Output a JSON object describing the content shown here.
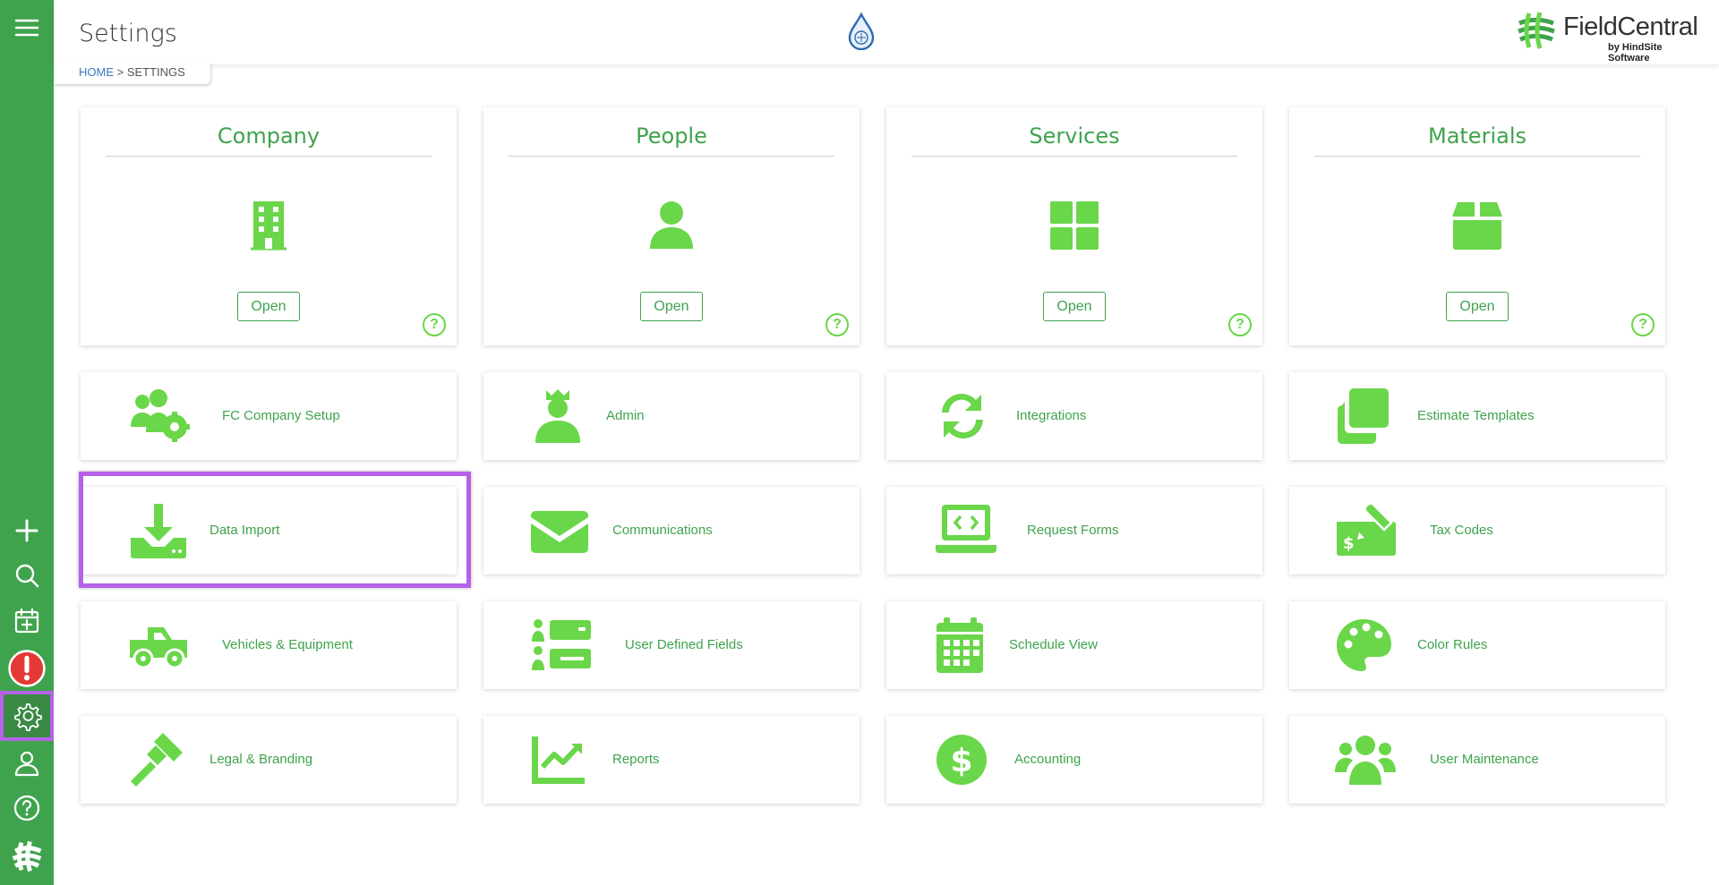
{
  "header": {
    "title": "Settings",
    "breadcrumb_home": "HOME",
    "breadcrumb_sep": " > ",
    "breadcrumb_current": "SETTINGS",
    "brand_name": "FieldCentral",
    "brand_sub": "by HindSite Software"
  },
  "sidebar": {
    "items": [
      {
        "icon": "menu-icon"
      },
      {
        "icon": "plus-icon"
      },
      {
        "icon": "search-icon"
      },
      {
        "icon": "calendar-add-icon"
      },
      {
        "icon": "alert-icon"
      },
      {
        "icon": "gear-icon",
        "active": true
      },
      {
        "icon": "user-icon"
      },
      {
        "icon": "help-icon"
      },
      {
        "icon": "fieldcentral-logo-icon"
      }
    ]
  },
  "main_cards": [
    {
      "title": "Company",
      "icon": "building-icon",
      "button": "Open",
      "help": "?"
    },
    {
      "title": "People",
      "icon": "person-icon",
      "button": "Open",
      "help": "?"
    },
    {
      "title": "Services",
      "icon": "grid-icon",
      "button": "Open",
      "help": "?"
    },
    {
      "title": "Materials",
      "icon": "box-icon",
      "button": "Open",
      "help": "?"
    }
  ],
  "tiles": [
    {
      "label": "FC Company Setup",
      "icon": "users-gear-icon"
    },
    {
      "label": "Admin",
      "icon": "admin-user-icon"
    },
    {
      "label": "Integrations",
      "icon": "sync-icon"
    },
    {
      "label": "Estimate Templates",
      "icon": "clone-icon"
    },
    {
      "label": "Data Import",
      "icon": "download-icon"
    },
    {
      "label": "Communications",
      "icon": "envelope-icon"
    },
    {
      "label": "Request Forms",
      "icon": "laptop-code-icon"
    },
    {
      "label": "Tax Codes",
      "icon": "money-check-edit-icon"
    },
    {
      "label": "Vehicles & Equipment",
      "icon": "truck-pickup-icon"
    },
    {
      "label": "User Defined Fields",
      "icon": "list-icon"
    },
    {
      "label": "Schedule View",
      "icon": "calendar-icon"
    },
    {
      "label": "Color Rules",
      "icon": "palette-icon"
    },
    {
      "label": "Legal & Branding",
      "icon": "gavel-icon"
    },
    {
      "label": "Reports",
      "icon": "chart-line-icon"
    },
    {
      "label": "Accounting",
      "icon": "dollar-circle-icon"
    },
    {
      "label": "User Maintenance",
      "icon": "users-icon"
    }
  ],
  "colors": {
    "sidebar": "#3fa34d",
    "accent": "#3fa34d",
    "icon": "#6ad64a",
    "highlight": "#b562e8",
    "alert": "#e53935"
  }
}
